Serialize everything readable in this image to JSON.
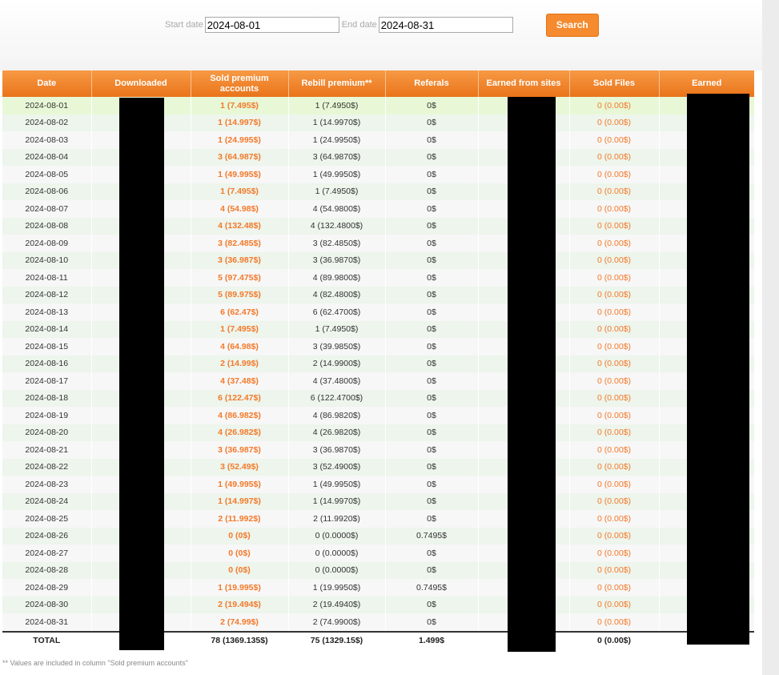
{
  "search": {
    "start_label": "Start date",
    "start_value": "2024-08-01",
    "end_label": "End date",
    "end_value": "2024-08-31",
    "button_label": "Search"
  },
  "table": {
    "headers": [
      "Date",
      "Downloaded",
      "Sold premium accounts",
      "Rebill premium**",
      "Referals",
      "Earned from sites",
      "Sold Files",
      "Earned"
    ],
    "rows": [
      {
        "date": "2024-08-01",
        "downloaded": "",
        "sold": "1 (7.495$)",
        "rebill": "1 (7.4950$)",
        "referals": "0$",
        "sites": "",
        "files": "0 (0.00$)",
        "earned": ""
      },
      {
        "date": "2024-08-02",
        "downloaded": "",
        "sold": "1 (14.997$)",
        "rebill": "1 (14.9970$)",
        "referals": "0$",
        "sites": "",
        "files": "0 (0.00$)",
        "earned": ""
      },
      {
        "date": "2024-08-03",
        "downloaded": "",
        "sold": "1 (24.995$)",
        "rebill": "1 (24.9950$)",
        "referals": "0$",
        "sites": "",
        "files": "0 (0.00$)",
        "earned": ""
      },
      {
        "date": "2024-08-04",
        "downloaded": "",
        "sold": "3 (64.987$)",
        "rebill": "3 (64.9870$)",
        "referals": "0$",
        "sites": "",
        "files": "0 (0.00$)",
        "earned": ""
      },
      {
        "date": "2024-08-05",
        "downloaded": "",
        "sold": "1 (49.995$)",
        "rebill": "1 (49.9950$)",
        "referals": "0$",
        "sites": "",
        "files": "0 (0.00$)",
        "earned": ""
      },
      {
        "date": "2024-08-06",
        "downloaded": "",
        "sold": "1 (7.495$)",
        "rebill": "1 (7.4950$)",
        "referals": "0$",
        "sites": "",
        "files": "0 (0.00$)",
        "earned": ""
      },
      {
        "date": "2024-08-07",
        "downloaded": "",
        "sold": "4 (54.98$)",
        "rebill": "4 (54.9800$)",
        "referals": "0$",
        "sites": "",
        "files": "0 (0.00$)",
        "earned": ""
      },
      {
        "date": "2024-08-08",
        "downloaded": "",
        "sold": "4 (132.48$)",
        "rebill": "4 (132.4800$)",
        "referals": "0$",
        "sites": "",
        "files": "0 (0.00$)",
        "earned": ""
      },
      {
        "date": "2024-08-09",
        "downloaded": "",
        "sold": "3 (82.485$)",
        "rebill": "3 (82.4850$)",
        "referals": "0$",
        "sites": "",
        "files": "0 (0.00$)",
        "earned": ""
      },
      {
        "date": "2024-08-10",
        "downloaded": "",
        "sold": "3 (36.987$)",
        "rebill": "3 (36.9870$)",
        "referals": "0$",
        "sites": "",
        "files": "0 (0.00$)",
        "earned": ""
      },
      {
        "date": "2024-08-11",
        "downloaded": "",
        "sold": "5 (97.475$)",
        "rebill": "4 (89.9800$)",
        "referals": "0$",
        "sites": "",
        "files": "0 (0.00$)",
        "earned": ""
      },
      {
        "date": "2024-08-12",
        "downloaded": "",
        "sold": "5 (89.975$)",
        "rebill": "4 (82.4800$)",
        "referals": "0$",
        "sites": "",
        "files": "0 (0.00$)",
        "earned": ""
      },
      {
        "date": "2024-08-13",
        "downloaded": "",
        "sold": "6 (62.47$)",
        "rebill": "6 (62.4700$)",
        "referals": "0$",
        "sites": "",
        "files": "0 (0.00$)",
        "earned": ""
      },
      {
        "date": "2024-08-14",
        "downloaded": "",
        "sold": "1 (7.495$)",
        "rebill": "1 (7.4950$)",
        "referals": "0$",
        "sites": "",
        "files": "0 (0.00$)",
        "earned": ""
      },
      {
        "date": "2024-08-15",
        "downloaded": "",
        "sold": "4 (64.98$)",
        "rebill": "3 (39.9850$)",
        "referals": "0$",
        "sites": "",
        "files": "0 (0.00$)",
        "earned": ""
      },
      {
        "date": "2024-08-16",
        "downloaded": "",
        "sold": "2 (14.99$)",
        "rebill": "2 (14.9900$)",
        "referals": "0$",
        "sites": "",
        "files": "0 (0.00$)",
        "earned": ""
      },
      {
        "date": "2024-08-17",
        "downloaded": "",
        "sold": "4 (37.48$)",
        "rebill": "4 (37.4800$)",
        "referals": "0$",
        "sites": "",
        "files": "0 (0.00$)",
        "earned": ""
      },
      {
        "date": "2024-08-18",
        "downloaded": "",
        "sold": "6 (122.47$)",
        "rebill": "6 (122.4700$)",
        "referals": "0$",
        "sites": "",
        "files": "0 (0.00$)",
        "earned": ""
      },
      {
        "date": "2024-08-19",
        "downloaded": "",
        "sold": "4 (86.982$)",
        "rebill": "4 (86.9820$)",
        "referals": "0$",
        "sites": "",
        "files": "0 (0.00$)",
        "earned": ""
      },
      {
        "date": "2024-08-20",
        "downloaded": "",
        "sold": "4 (26.982$)",
        "rebill": "4 (26.9820$)",
        "referals": "0$",
        "sites": "",
        "files": "0 (0.00$)",
        "earned": ""
      },
      {
        "date": "2024-08-21",
        "downloaded": "",
        "sold": "3 (36.987$)",
        "rebill": "3 (36.9870$)",
        "referals": "0$",
        "sites": "",
        "files": "0 (0.00$)",
        "earned": ""
      },
      {
        "date": "2024-08-22",
        "downloaded": "",
        "sold": "3 (52.49$)",
        "rebill": "3 (52.4900$)",
        "referals": "0$",
        "sites": "",
        "files": "0 (0.00$)",
        "earned": ""
      },
      {
        "date": "2024-08-23",
        "downloaded": "",
        "sold": "1 (49.995$)",
        "rebill": "1 (49.9950$)",
        "referals": "0$",
        "sites": "",
        "files": "0 (0.00$)",
        "earned": ""
      },
      {
        "date": "2024-08-24",
        "downloaded": "",
        "sold": "1 (14.997$)",
        "rebill": "1 (14.9970$)",
        "referals": "0$",
        "sites": "",
        "files": "0 (0.00$)",
        "earned": ""
      },
      {
        "date": "2024-08-25",
        "downloaded": "",
        "sold": "2 (11.992$)",
        "rebill": "2 (11.9920$)",
        "referals": "0$",
        "sites": "",
        "files": "0 (0.00$)",
        "earned": ""
      },
      {
        "date": "2024-08-26",
        "downloaded": "",
        "sold": "0 (0$)",
        "rebill": "0 (0.0000$)",
        "referals": "0.7495$",
        "sites": "",
        "files": "0 (0.00$)",
        "earned": ""
      },
      {
        "date": "2024-08-27",
        "downloaded": "",
        "sold": "0 (0$)",
        "rebill": "0 (0.0000$)",
        "referals": "0$",
        "sites": "",
        "files": "0 (0.00$)",
        "earned": ""
      },
      {
        "date": "2024-08-28",
        "downloaded": "",
        "sold": "0 (0$)",
        "rebill": "0 (0.0000$)",
        "referals": "0$",
        "sites": "",
        "files": "0 (0.00$)",
        "earned": ""
      },
      {
        "date": "2024-08-29",
        "downloaded": "",
        "sold": "1 (19.995$)",
        "rebill": "1 (19.9950$)",
        "referals": "0.7495$",
        "sites": "",
        "files": "0 (0.00$)",
        "earned": ""
      },
      {
        "date": "2024-08-30",
        "downloaded": "",
        "sold": "2 (19.494$)",
        "rebill": "2 (19.4940$)",
        "referals": "0$",
        "sites": "",
        "files": "0 (0.00$)",
        "earned": ""
      },
      {
        "date": "2024-08-31",
        "downloaded": "",
        "sold": "2 (74.99$)",
        "rebill": "2 (74.9900$)",
        "referals": "0$",
        "sites": "",
        "files": "0 (0.00$)",
        "earned": ""
      }
    ],
    "total": {
      "label": "TOTAL",
      "downloaded": "",
      "sold": "78 (1369.135$)",
      "rebill": "75 (1329.15$)",
      "referals": "1.499$",
      "sites": "",
      "files": "0 (0.00$)",
      "earned": ""
    }
  },
  "footnote": "** Values are included in column \"Sold premium accounts\"",
  "colors": {
    "header_orange": "#f58a2e",
    "value_orange": "#f4792a",
    "row_highlight": "#e8f8d6",
    "row_alt": "#edf5ec",
    "redaction": "#000000"
  }
}
